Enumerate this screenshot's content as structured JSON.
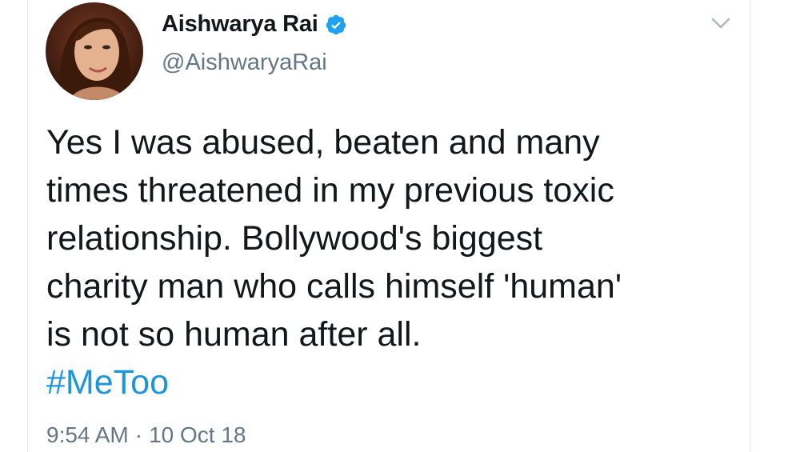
{
  "tweet": {
    "author": {
      "display_name": "Aishwarya Rai",
      "handle": "@AishwaryaRai",
      "verified": true
    },
    "text_lines": [
      "Yes I was abused, beaten and many",
      "times threatened in my previous toxic",
      "relationship. Bollywood's biggest",
      "charity man who calls himself 'human'",
      "is not so human after all."
    ],
    "hashtag": "#MeToo",
    "time": "9:54 AM",
    "separator": "·",
    "date": "10 Oct 18"
  },
  "icons": {
    "verified": "verified-badge-icon",
    "menu": "chevron-down-icon"
  },
  "colors": {
    "text": "#14171a",
    "secondary": "#657786",
    "link": "#1b95e0",
    "verified": "#1da1f2"
  }
}
